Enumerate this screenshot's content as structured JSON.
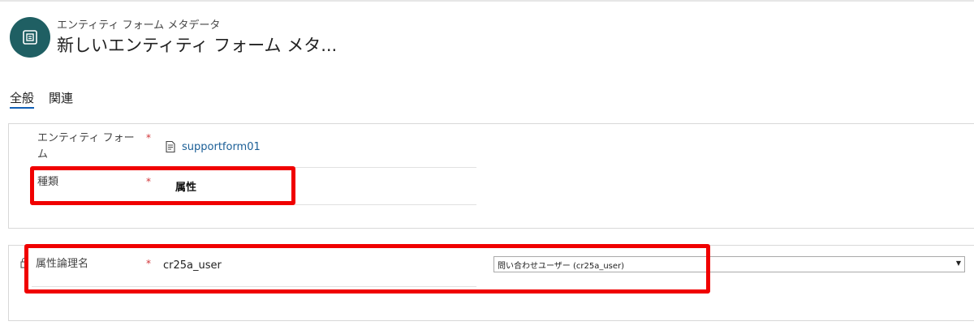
{
  "header": {
    "entity_type": "エンティティ フォーム メタデータ",
    "record_title": "新しいエンティティ フォーム メタ...",
    "icon": "entity-form-icon",
    "icon_color": "#1f5f63"
  },
  "tabs": [
    {
      "label": "全般",
      "selected": true
    },
    {
      "label": "関連",
      "selected": false
    }
  ],
  "section1": {
    "entity_form": {
      "label": "エンティティ フォーム",
      "required_mark": "*",
      "value": "supportform01",
      "icon": "record-lookup-icon"
    },
    "type": {
      "label": "種類",
      "required_mark": "*",
      "value": "属性"
    }
  },
  "section2": {
    "attribute_logical_name": {
      "label": "属性論理名",
      "required_mark": "*",
      "value": "cr25a_user",
      "icon": "lock-icon",
      "select_value": "問い合わせユーザー (cr25a_user)"
    }
  },
  "colors": {
    "accent": "#1160b7",
    "link": "#1a5e96",
    "required": "#d13438",
    "annotation": "#f00000"
  }
}
